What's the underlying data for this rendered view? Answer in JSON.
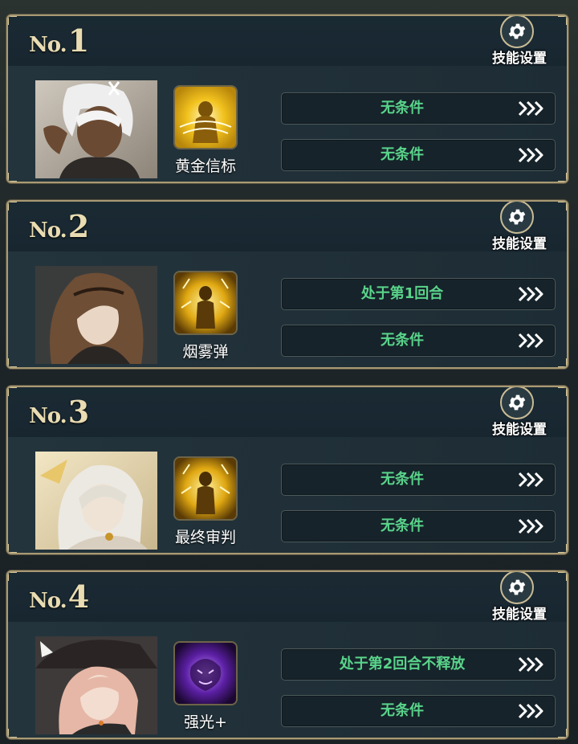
{
  "gear_label": "技能设置",
  "colors": {
    "condition_text": "#59d38a",
    "frame_gold": "#a99a74",
    "rank_text": "#e9dcb2"
  },
  "slots": [
    {
      "prefix": "No.",
      "number": "1",
      "skill_name": "黄金信标",
      "skill_icon": "golden-beacon-icon",
      "skill_tint": "gold",
      "conditions": [
        "无条件",
        "无条件"
      ]
    },
    {
      "prefix": "No.",
      "number": "2",
      "skill_name": "烟雾弹",
      "skill_icon": "smoke-bomb-icon",
      "skill_tint": "gold",
      "conditions": [
        "处于第1回合",
        "无条件"
      ]
    },
    {
      "prefix": "No.",
      "number": "3",
      "skill_name": "最终审判",
      "skill_icon": "final-judgment-icon",
      "skill_tint": "gold",
      "conditions": [
        "无条件",
        "无条件"
      ]
    },
    {
      "prefix": "No.",
      "number": "4",
      "skill_name": "强光+",
      "skill_icon": "strong-light-icon",
      "skill_tint": "purple",
      "conditions": [
        "处于第2回合不释放",
        "无条件"
      ]
    }
  ]
}
